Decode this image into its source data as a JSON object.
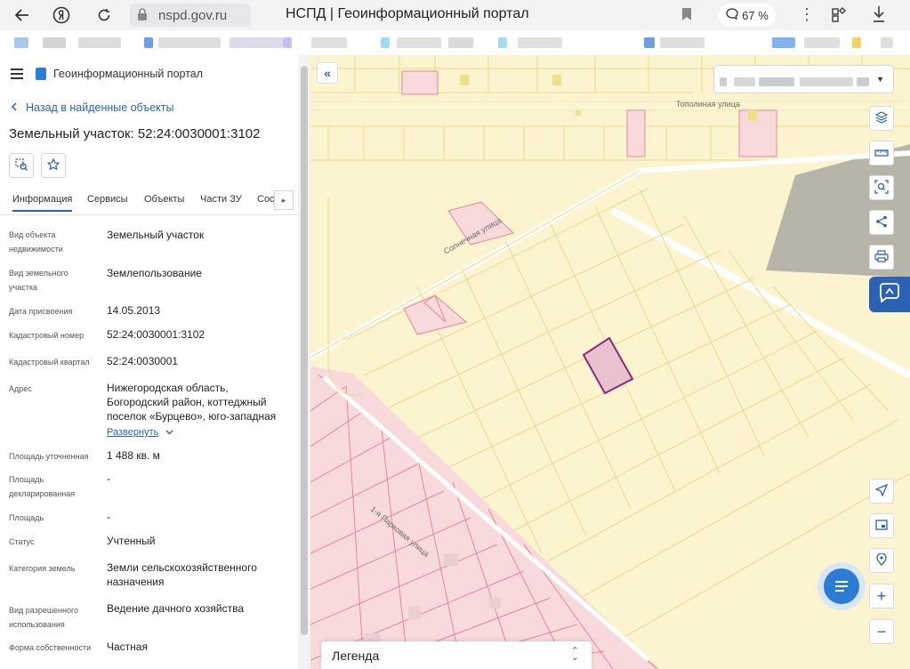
{
  "browser": {
    "url": "nspd.gov.ru",
    "tab_title": "НСПД | Геоинформационный портал",
    "zoom": "67 %"
  },
  "panel": {
    "portal_name": "Геоинформационный портал",
    "back_label": "Назад в найденные объекты",
    "object_title": "Земельный участок: 52:24:0030001:3102",
    "tabs": [
      "Информация",
      "Сервисы",
      "Объекты",
      "Части ЗУ",
      "Сос"
    ],
    "active_tab": "Информация",
    "fields": [
      {
        "label": "Вид объекта недвижимости",
        "value": "Земельный участок"
      },
      {
        "label": "Вид земельного участка",
        "value": "Землепользование"
      },
      {
        "label": "Дата присвоения",
        "value": "14.05.2013"
      },
      {
        "label": "Кадастровый номер",
        "value": "52:24:0030001:3102"
      },
      {
        "label": "Кадастровый квартал",
        "value": "52:24:0030001"
      },
      {
        "label": "Адрес",
        "value": "Нижегородская область, Богородский район, коттеджный поселок «Бурцево», юго-западная"
      },
      {
        "label": "Площадь уточненная",
        "value": "1 488 кв. м"
      },
      {
        "label": "Площадь декларированная",
        "value": "-"
      },
      {
        "label": "Площадь",
        "value": "-"
      },
      {
        "label": "Статус",
        "value": "Учтенный"
      },
      {
        "label": "Категория земель",
        "value": "Земли сельскохозяйственного назначения"
      },
      {
        "label": "Вид разрешенного использования",
        "value": "Ведение дачного хозяйства"
      },
      {
        "label": "Форма собственности",
        "value": "Частная"
      }
    ],
    "expand_label": "Развернуть"
  },
  "map": {
    "street_labels": [
      "Тополиная улица",
      "Солнечная улица",
      "1-я Парковая улица"
    ],
    "legend_label": "Легенда",
    "colors": {
      "parcel_fill": "#fbf4cf",
      "parcel_line": "#e6d88a",
      "pink_zone": "#f8d9dc",
      "pink_line": "#e08a93",
      "selected_fill": "#e9c1cf",
      "selected_line": "#8b2b7a",
      "accent": "#2b62b5"
    }
  }
}
